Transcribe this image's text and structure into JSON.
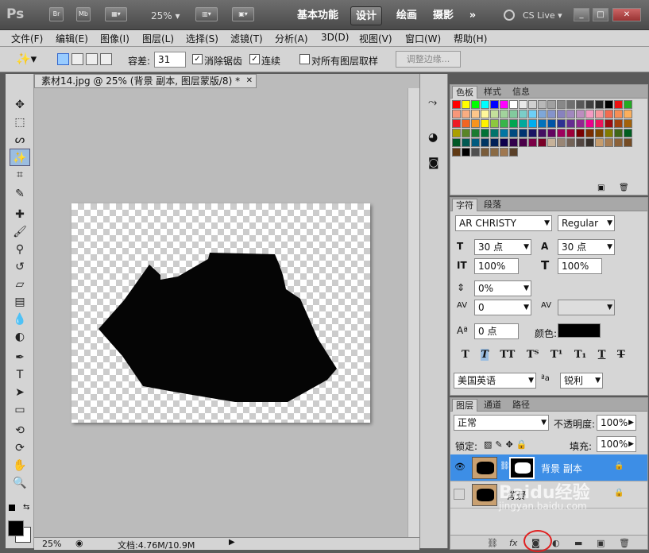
{
  "titlebar": {
    "app_logo": "Ps",
    "bridge_btn": "Br",
    "minibridge_btn": "Mb",
    "zoom": "25%",
    "workspaces": [
      "基本功能",
      "设计",
      "绘画",
      "摄影"
    ],
    "more": "»",
    "cslive": "CS Live"
  },
  "menubar": [
    "文件(F)",
    "编辑(E)",
    "图像(I)",
    "图层(L)",
    "选择(S)",
    "滤镜(T)",
    "分析(A)",
    "3D(D)",
    "视图(V)",
    "窗口(W)",
    "帮助(H)"
  ],
  "options": {
    "tolerance_label": "容差:",
    "tolerance_value": "31",
    "antialias_label": "消除锯齿",
    "contiguous_label": "连续",
    "sample_all_label": "对所有图层取样",
    "refine_edge_label": "调整边缘..."
  },
  "document": {
    "tab_title": "素材14.jpg @ 25% (背景 副本, 图层蒙版/8) *",
    "zoom_status": "25%",
    "doc_info": "文档:4.76M/10.9M"
  },
  "swatches_panel": {
    "tabs": [
      "色板",
      "样式",
      "信息"
    ]
  },
  "character_panel": {
    "tabs": [
      "字符",
      "段落"
    ],
    "font_family": "AR CHRISTY",
    "font_style": "Regular",
    "font_size": "30 点",
    "leading": "30 点",
    "vertical_scale": "100%",
    "horizontal_scale": "100%",
    "tracking_ratio": "0%",
    "kerning": "0",
    "baseline_shift": "0 点",
    "color_label": "颜色:",
    "language": "美国英语",
    "antialias": "锐利"
  },
  "layers_panel": {
    "tabs": [
      "图层",
      "通道",
      "路径"
    ],
    "blend_mode": "正常",
    "opacity_label": "不透明度:",
    "opacity": "100%",
    "lock_label": "锁定:",
    "fill_label": "填充:",
    "fill": "100%",
    "layers": [
      {
        "name": "背景 副本",
        "selected": true,
        "visible": true
      },
      {
        "name": "背景",
        "selected": false,
        "visible": false
      }
    ]
  },
  "watermark": {
    "text": "Baidu经验",
    "url": "jingyan.baidu.com"
  },
  "colors": {
    "accent_selected": "#3d8ee6",
    "highlight_circle": "#e02020"
  }
}
